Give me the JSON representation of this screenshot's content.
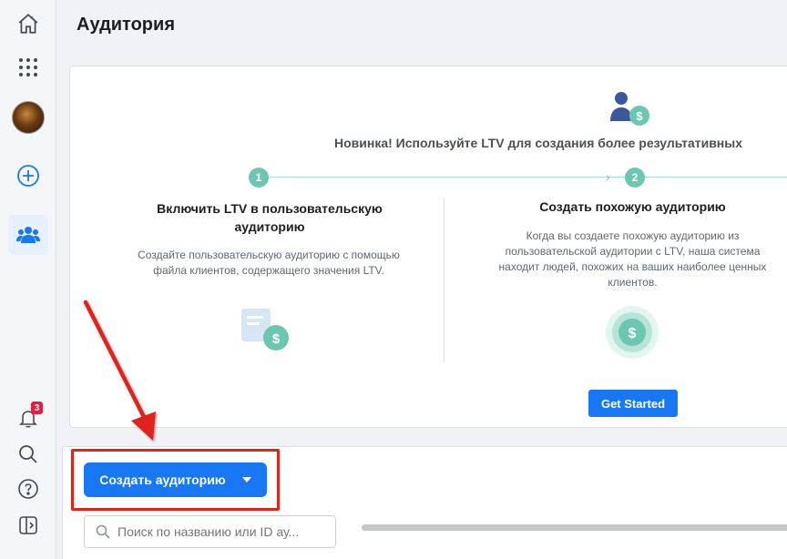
{
  "page": {
    "title": "Аудитория"
  },
  "sidebar": {
    "items": [
      {
        "icon": "home-icon"
      },
      {
        "icon": "apps-grid-icon"
      },
      {
        "icon": "avatar"
      },
      {
        "icon": "plus-circle-icon"
      },
      {
        "icon": "audience-people-icon"
      }
    ],
    "bottom_items": [
      {
        "icon": "bell-icon",
        "badge": "3"
      },
      {
        "icon": "search-icon"
      },
      {
        "icon": "help-icon"
      },
      {
        "icon": "panel-toggle-icon"
      }
    ]
  },
  "ltv_card": {
    "headline": "Новинка! Используйте LTV для создания более результативных",
    "steps": [
      "1",
      "2"
    ],
    "step1": {
      "title_line1": "Включить LTV в пользовательскую",
      "title_line2": "аудиторию",
      "desc_line1": "Создайте пользовательскую аудиторию с помощью",
      "desc_line2": "файла клиентов, содержащего значения LTV."
    },
    "step2": {
      "title": "Создать похожую аудиторию",
      "desc_line1": "Когда вы создаете похожую аудиторию из",
      "desc_line2": "пользовательской аудитории с LTV, наша система",
      "desc_line3": "находит людей, похожих на ваших наиболее ценных",
      "desc_line4": "клиентов."
    },
    "cta": "Get Started"
  },
  "toolbar": {
    "create_label": "Создать аудиторию",
    "search_placeholder": "Поиск по названию или ID ау..."
  },
  "colors": {
    "accent": "#1877f2",
    "teal": "#6cc7b0",
    "annotation_red": "#e2231a",
    "badge_red": "#e41e3f"
  }
}
